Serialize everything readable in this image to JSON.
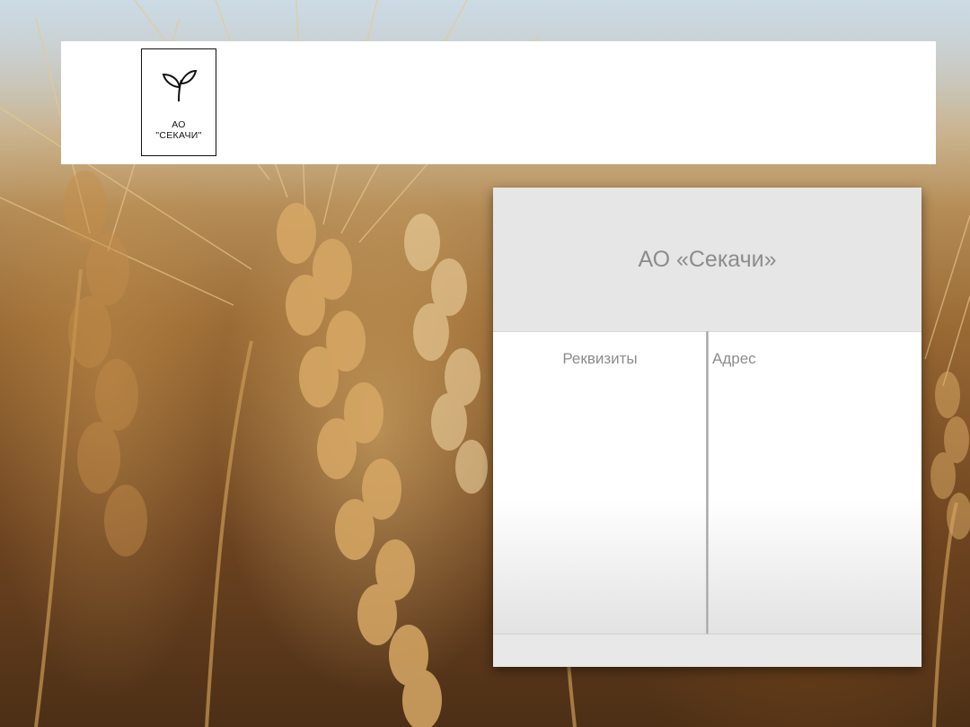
{
  "logo": {
    "icon": "sprout-icon",
    "line1": "АО",
    "line2": "\"СЕКАЧИ\""
  },
  "card": {
    "title": "АО «Секачи»",
    "left_column_label": "Реквизиты",
    "right_column_label": "Адрес"
  },
  "colors": {
    "header_bg": "#ffffff",
    "card_head_bg": "#e6e6e6",
    "text_gray": "#8c8c8c"
  }
}
